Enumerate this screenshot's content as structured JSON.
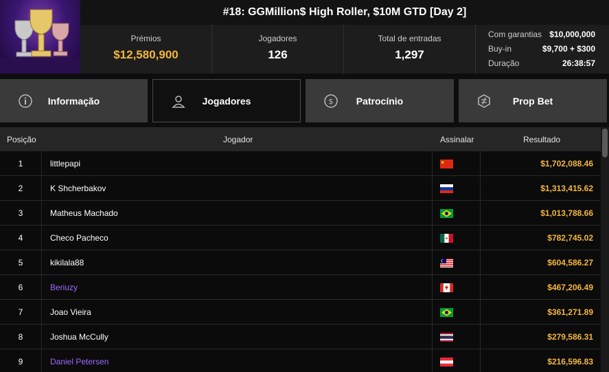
{
  "tournament": {
    "title": "#18: GGMillion$ High Roller, $10M GTD [Day 2]"
  },
  "stats": {
    "prize_label": "Prémios",
    "prize_value": "$12,580,900",
    "players_label": "Jogadores",
    "players_value": "126",
    "entries_label": "Total de entradas",
    "entries_value": "1,297",
    "guarantee_label": "Com garantias",
    "guarantee_value": "$10,000,000",
    "buyin_label": "Buy-in",
    "buyin_value": "$9,700 + $300",
    "duration_label": "Duração",
    "duration_value": "26:38:57"
  },
  "tabs": [
    {
      "label": "Informação",
      "icon": "info-icon",
      "active": false
    },
    {
      "label": "Jogadores",
      "icon": "user-icon",
      "active": true
    },
    {
      "label": "Patrocínio",
      "icon": "dollar-coin-icon",
      "active": false
    },
    {
      "label": "Prop Bet",
      "icon": "prop-bet-icon",
      "active": false
    }
  ],
  "table": {
    "headers": {
      "position": "Posição",
      "player": "Jogador",
      "flag": "Assinalar",
      "result": "Resultado"
    },
    "rows": [
      {
        "pos": "1",
        "name": "littlepapi",
        "flag": "china",
        "result": "$1,702,088.46",
        "highlight": false
      },
      {
        "pos": "2",
        "name": "K Shcherbakov",
        "flag": "russia",
        "result": "$1,313,415.62",
        "highlight": false
      },
      {
        "pos": "3",
        "name": "Matheus Machado",
        "flag": "brazil",
        "result": "$1,013,788.66",
        "highlight": false
      },
      {
        "pos": "4",
        "name": "Checo Pacheco",
        "flag": "mexico",
        "result": "$782,745.02",
        "highlight": false
      },
      {
        "pos": "5",
        "name": "kikilala88",
        "flag": "malaysia",
        "result": "$604,586.27",
        "highlight": false
      },
      {
        "pos": "6",
        "name": "Beriuzy",
        "flag": "canada",
        "result": "$467,206.49",
        "highlight": true
      },
      {
        "pos": "7",
        "name": "Joao Vieira",
        "flag": "brazil",
        "result": "$361,271.89",
        "highlight": false
      },
      {
        "pos": "8",
        "name": "Joshua McCully",
        "flag": "thailand",
        "result": "$279,586.31",
        "highlight": false
      },
      {
        "pos": "9",
        "name": "Daniel Petersen",
        "flag": "austria",
        "result": "$216,596.83",
        "highlight": true
      }
    ]
  },
  "colors": {
    "gold": "#f4b63f",
    "purple_name": "#9d6bff",
    "tab_bg": "#3a3a3a",
    "tab_active_bg": "#101010"
  }
}
